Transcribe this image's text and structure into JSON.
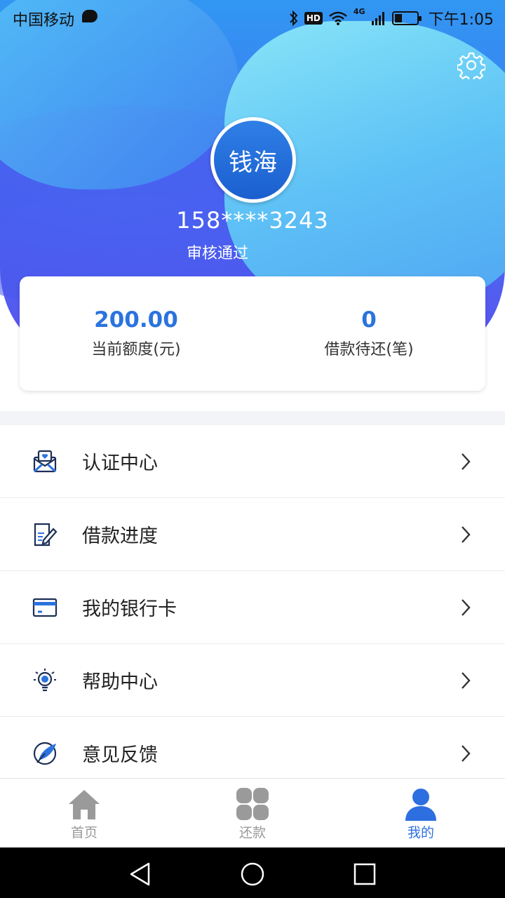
{
  "status_bar": {
    "carrier": "中国移动",
    "network": "4G",
    "hd": "HD",
    "time": "下午1:05"
  },
  "profile": {
    "avatar_text": "钱海",
    "phone": "158****3243",
    "status": "审核通过"
  },
  "stats": {
    "credit_value": "200.00",
    "credit_label": "当前额度(元)",
    "pending_value": "0",
    "pending_label": "借款待还(笔)"
  },
  "menu": {
    "items": [
      {
        "label": "认证中心",
        "icon": "certification-icon"
      },
      {
        "label": "借款进度",
        "icon": "document-edit-icon"
      },
      {
        "label": "我的银行卡",
        "icon": "bank-card-icon"
      },
      {
        "label": "帮助中心",
        "icon": "lightbulb-icon"
      },
      {
        "label": "意见反馈",
        "icon": "feather-icon"
      }
    ]
  },
  "tabs": [
    {
      "label": "首页",
      "icon": "home-icon",
      "active": false
    },
    {
      "label": "还款",
      "icon": "grid-icon",
      "active": false
    },
    {
      "label": "我的",
      "icon": "user-icon",
      "active": true
    }
  ],
  "colors": {
    "accent": "#2b73de",
    "tab_inactive": "#9a9a9a"
  }
}
